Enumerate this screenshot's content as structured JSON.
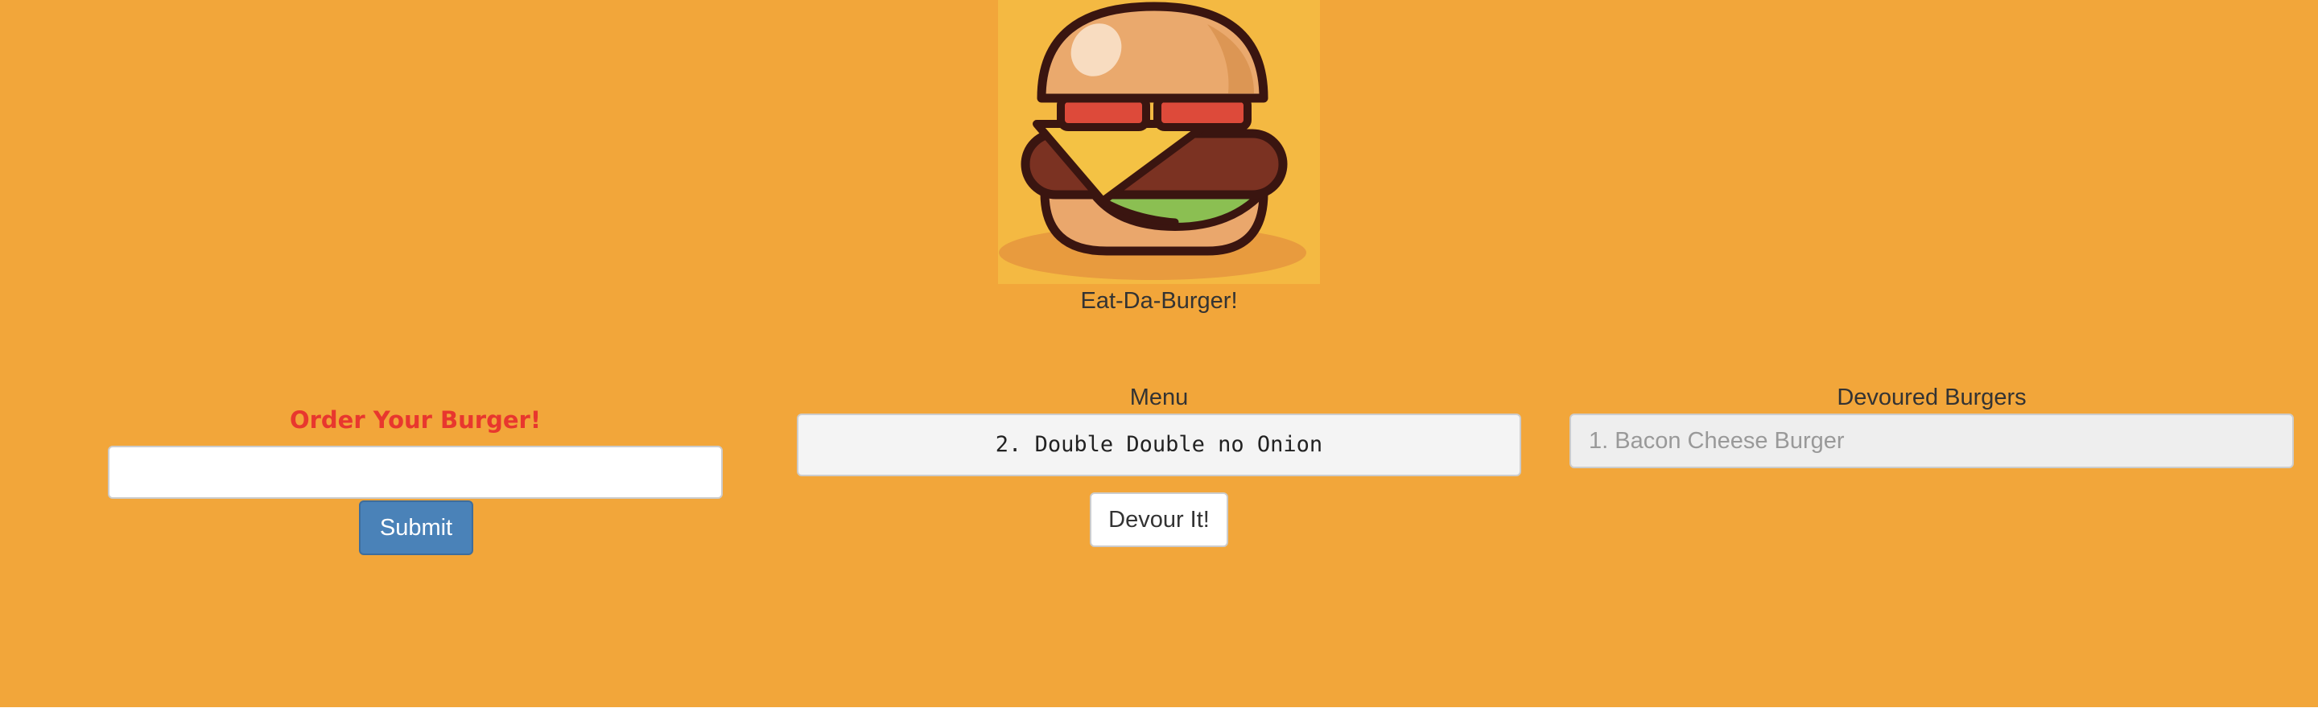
{
  "header": {
    "logo_icon": "burger-logo-icon",
    "title": "Eat-Da-Burger!"
  },
  "order": {
    "title": "Order Your Burger!",
    "input_value": "",
    "input_placeholder": "",
    "submit_label": "Submit"
  },
  "menu": {
    "title": "Menu",
    "items": [
      {
        "label": "2. Double Double no Onion"
      }
    ],
    "devour_label": "Devour It!"
  },
  "devoured": {
    "title": "Devoured Burgers",
    "items": [
      {
        "label": "1. Bacon Cheese Burger"
      }
    ]
  },
  "colors": {
    "background": "#f2a63a",
    "logo_background": "#f4b942",
    "order_title": "#e8372e",
    "submit_button": "#4a82b8"
  }
}
